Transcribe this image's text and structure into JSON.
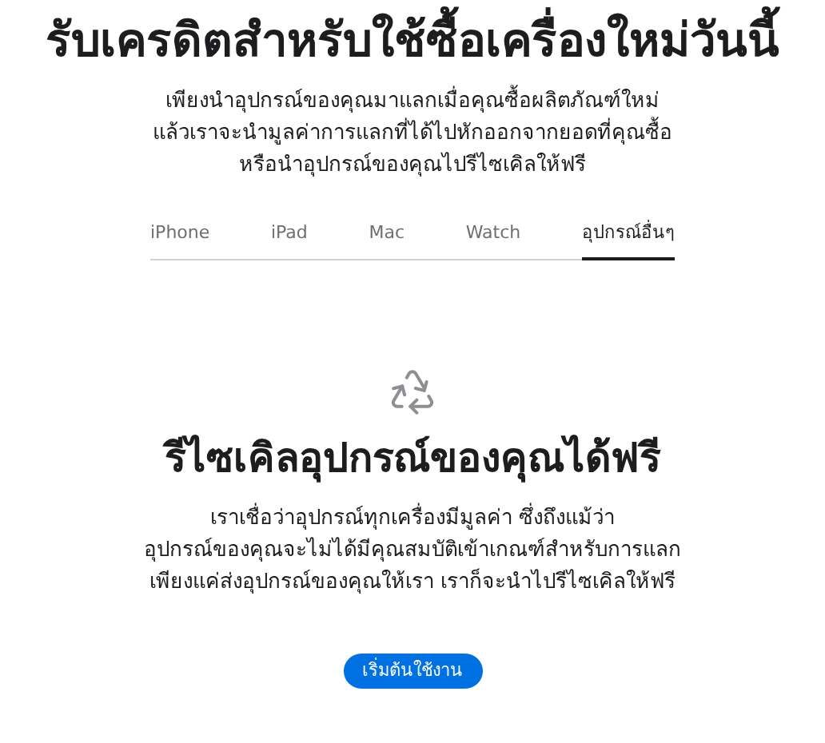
{
  "title": "รับเครดิตสำหรับใช้ซื้อเครื่องใหม่วันนี้",
  "intro_lines": [
    "เพียงนำอุปกรณ์ของคุณมาแลกเมื่อคุณซื้อผลิตภัณฑ์ใหม่",
    "แล้วเราจะนำมูลค่าการแลกที่ได้ไปหักออกจากยอดที่คุณซื้อ",
    "หรือนำอุปกรณ์ของคุณไปรีไซเคิลให้ฟรี"
  ],
  "tabs": [
    {
      "label": "iPhone",
      "selected": false
    },
    {
      "label": "iPad",
      "selected": false
    },
    {
      "label": "Mac",
      "selected": false
    },
    {
      "label": "Watch",
      "selected": false
    },
    {
      "label": "อุปกรณ์อื่นๆ",
      "selected": true
    }
  ],
  "section": {
    "heading": "รีไซเคิลอุปกรณ์ของคุณได้ฟรี",
    "body_lines": [
      "เราเชื่อว่าอุปกรณ์ทุกเครื่องมีมูลค่า ซึ่งถึงแม้ว่า",
      "อุปกรณ์ของคุณจะไม่ได้มีคุณสมบัติเข้าเกณฑ์สำหรับการแลก",
      "เพียงแค่ส่งอุปกรณ์ของคุณให้เรา เราก็จะนำไปรีไซเคิลให้ฟรี"
    ],
    "button": "เริ่มต้นใช้งาน"
  }
}
